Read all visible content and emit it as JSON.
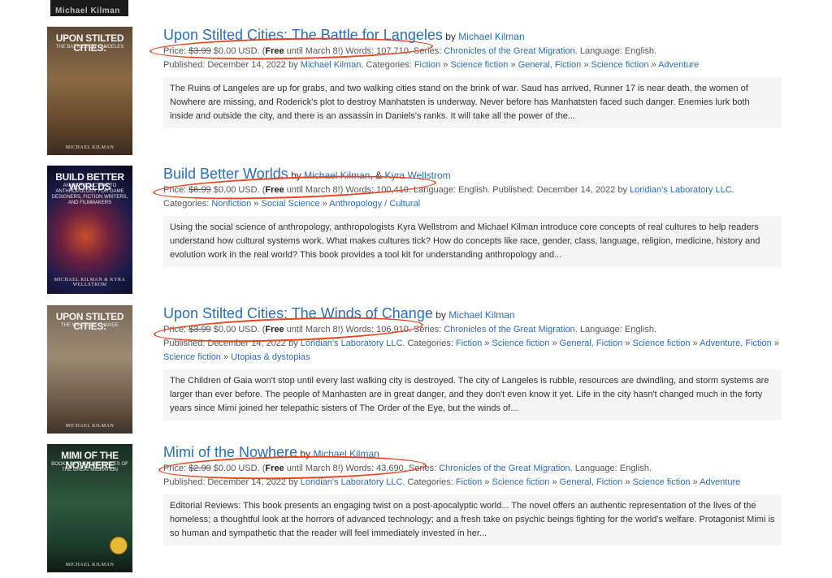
{
  "top_cover": {
    "text": "Michael Kilman"
  },
  "books": [
    {
      "cover_title": "Upon Stilted Cities:",
      "cover_subtitle": "The Battle for Langeles",
      "cover_author": "Michael Kilman",
      "title": "Upon Stilted Cities: The Battle for Langeles",
      "by": "by",
      "authors": [
        "Michael Kilman"
      ],
      "line1": {
        "price_label": "Price:",
        "old_price": "$3.99",
        "new_price": "$0.00 USD. (",
        "free": "Free",
        "until": "until March 8!) Words: 107,710. Series:",
        "series": "Chronicles of the Great Migration",
        "tail": ". Language: English."
      },
      "line2": {
        "published": "Published: December 14, 2022 by",
        "publisher": "Michael Kilman",
        "categories_label": ". Categories:",
        "categories": [
          "Fiction",
          "Science fiction",
          "General, Fiction",
          "Science fiction",
          "Adventure"
        ]
      },
      "description": "The Ruins of Langeles are up for grabs, and two walking cities stand on the brink of war. Saud has arrived, Runner 17 is near death, the women of Nowhere are missing, and Roderick's plot to destroy Manhatsten is underway. Never before has Manhatsten faced such danger. Enemies lurk both inside and outside the city, and there is an assassin in Daniels's ranks. It will take all the power of the..."
    },
    {
      "cover_title": "Build Better Worlds",
      "cover_subtitle": "An introduction to anthropology for game designers, fiction writers, and filmmakers",
      "cover_author": "Michael Kilman & Kyra Wellstrom",
      "title": "Build Better Worlds",
      "by": "by",
      "authors": [
        "Michael Kilman",
        "Kyra Wellstrom"
      ],
      "author_sep": ", &",
      "line1": {
        "price_label": "Price:",
        "old_price": "$6.99",
        "new_price": "$0.00 USD. (",
        "free": "Free",
        "until": "until March 8!) Words: 100,410. Language: English. Published: December 14, 2022 by",
        "publisher": "Loridian's Laboratory LLC",
        "tail": "."
      },
      "line2": {
        "categories_label": "Categories:",
        "categories": [
          "Nonfiction",
          "Social Science",
          "Anthropology / Cultural"
        ]
      },
      "description": "Using the social science of anthropology, anthropologists Kyra Wellstrom and Michael Kilman introduce core concepts of real cultures to help readers understand how cultural systems work. What makes cultures tick? How do concepts like race, gender, class, language, religion, medicine, history and evolution work in the real world? This book provides a tool kit for understanding anthropology and..."
    },
    {
      "cover_title": "Upon Stilted Cities:",
      "cover_subtitle": "The Winds of Change",
      "cover_author": "Michael Kilman",
      "title": "Upon Stilted Cities: The Winds of Change",
      "by": "by",
      "authors": [
        "Michael Kilman"
      ],
      "line1": {
        "price_label": "Price:",
        "old_price": "$3.99",
        "new_price": "$0.00 USD. (",
        "free": "Free",
        "until": "until March 8!) Words: 106,910. Series:",
        "series": "Chronicles of the Great Migration",
        "tail": ". Language: English."
      },
      "line2": {
        "published": "Published: December 14, 2022 by",
        "publisher": "Loridian's Laboratory LLC",
        "categories_label": ". Categories:",
        "categories": [
          "Fiction",
          "Science fiction",
          "General, Fiction",
          "Science fiction",
          "Adventure,",
          "Fiction",
          "Science fiction",
          "Utopias & dystopias"
        ]
      },
      "description": "The Children of Gaia won't stop until every last walking city is destroyed. The city of Langeles is rubble, resources are dwindling, and storm systems are larger than ever before. The people of Manhasten are in great danger, and they don't even know it yet. Life in the city hasn't changed much in the forty years since Mimi joined her telepathic sisters of The Order of the Eye, but the winds of..."
    },
    {
      "cover_title": "Mimi of the Nowhere",
      "cover_subtitle": "Book 1 in the Chronicles of the Great Migration",
      "cover_author": "Michael Kilman",
      "title": "Mimi of the Nowhere",
      "by": "by",
      "authors": [
        "Michael Kilman"
      ],
      "line1": {
        "price_label": "Price:",
        "old_price": "$2.99",
        "new_price": "$0.00 USD. (",
        "free": "Free",
        "until": "until March 8!) Words: 43,690. Series:",
        "series": "Chronicles of the Great Migration",
        "tail": ". Language: English."
      },
      "line2": {
        "published": "Published: December 14, 2022 by",
        "publisher": "Loridian's Laboratory LLC",
        "categories_label": ". Categories:",
        "categories": [
          "Fiction",
          "Science fiction",
          "General, Fiction",
          "Science fiction",
          "Adventure"
        ]
      },
      "description": "Editorial Reviews: This book presents an engaging twist on a post-apocalyptic world... The novel offers an authentic representation of the lives of the homeless; a thoughtful look at the horrors of advanced technology; and a fresh take on psychic beings fighting for the world's welfare. Protagonist Mimi is so human and sympathetic that the reader will feel immediately invested in her..."
    }
  ],
  "sep": " » ",
  "colors": {
    "link": "#2a6ebb",
    "annotation": "#e8451f",
    "desc_bg": "#f5f5f5"
  }
}
